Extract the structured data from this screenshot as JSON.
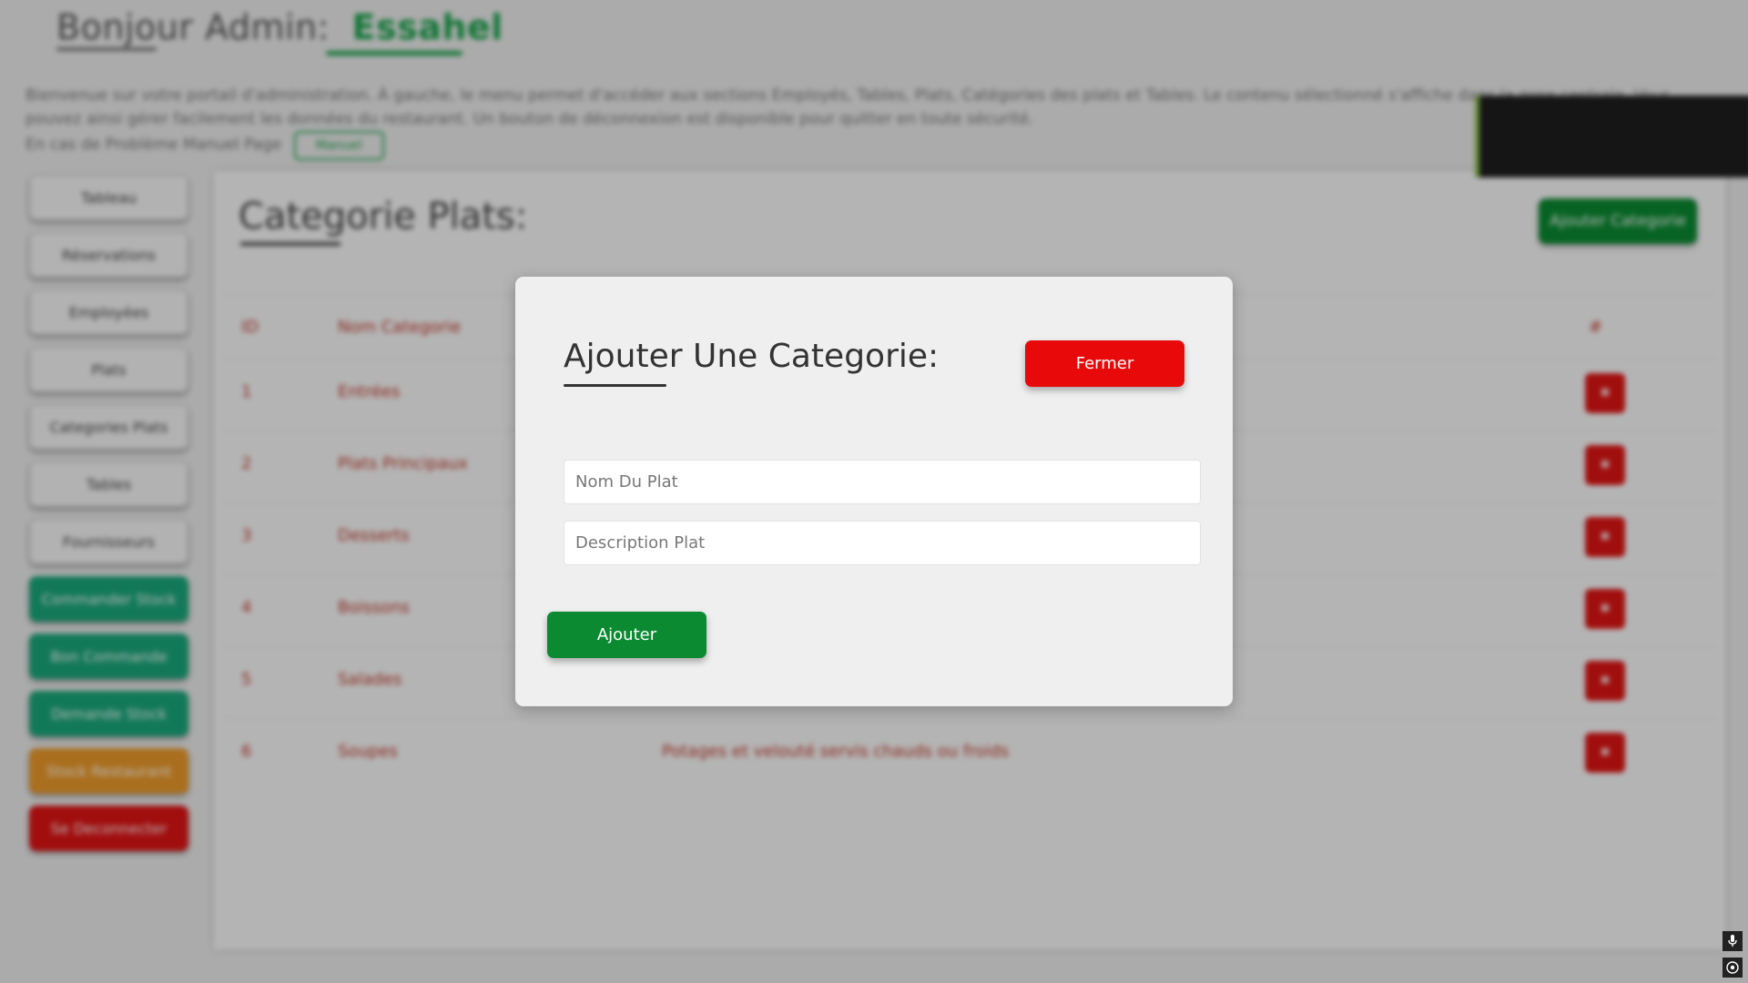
{
  "header": {
    "greeting": "Bonjour Admin:",
    "admin_name": "Essahel"
  },
  "intro": {
    "text": "Bienvenue sur votre portail d'administration. À gauche, le menu permet d'accéder aux sections Employés, Tables, Plats, Catégories des plats et Tables. Le contenu sélectionné s'affiche dans la zone centrale. Vous pouvez ainsi gérer facilement les données du restaurant. Un bouton de déconnexion est disponible pour quitter en toute sécurité.",
    "line2": "En cas de Problème Manuel Page",
    "read_more": "Manuel"
  },
  "sidebar": {
    "items": [
      {
        "label": "Tableau",
        "style": "default"
      },
      {
        "label": "Réservations",
        "style": "default"
      },
      {
        "label": "Employées",
        "style": "default"
      },
      {
        "label": "Plats",
        "style": "default"
      },
      {
        "label": "Categories Plats",
        "style": "default"
      },
      {
        "label": "Tables",
        "style": "default"
      },
      {
        "label": "Fournisseurs",
        "style": "default"
      },
      {
        "label": "Commander Stock",
        "style": "teal"
      },
      {
        "label": "Bon Commande",
        "style": "teal"
      },
      {
        "label": "Demande Stock",
        "style": "teal"
      },
      {
        "label": "Stock Restaurant",
        "style": "orange"
      },
      {
        "label": "Se Deconnecter",
        "style": "red"
      }
    ]
  },
  "main": {
    "title": "Categorie Plats:",
    "add_button": "Ajouter Categorie",
    "table": {
      "headers": [
        "ID",
        "Nom Categorie",
        "",
        "#"
      ],
      "rows": [
        {
          "id": "1",
          "name": "Entrées",
          "description": ""
        },
        {
          "id": "2",
          "name": "Plats Principaux",
          "description": ""
        },
        {
          "id": "3",
          "name": "Desserts",
          "description": ""
        },
        {
          "id": "4",
          "name": "Boissons",
          "description": ""
        },
        {
          "id": "5",
          "name": "Salades",
          "description": ""
        },
        {
          "id": "6",
          "name": "Soupes",
          "description": "Potages et velouté servis chauds ou froids"
        }
      ]
    }
  },
  "modal": {
    "title": "Ajouter Une Categorie:",
    "close_label": "Fermer",
    "name_placeholder": "Nom Du Plat",
    "description_placeholder": "Description Plat",
    "submit_label": "Ajouter"
  },
  "colors": {
    "primary_green": "#0b8a32",
    "danger_red": "#e80a0a",
    "teal": "#1aa87a",
    "orange": "#ec9a2a",
    "modal_bg": "#efefef"
  },
  "icons": {
    "mic": "microphone-icon",
    "accessibility": "accessibility-icon"
  }
}
